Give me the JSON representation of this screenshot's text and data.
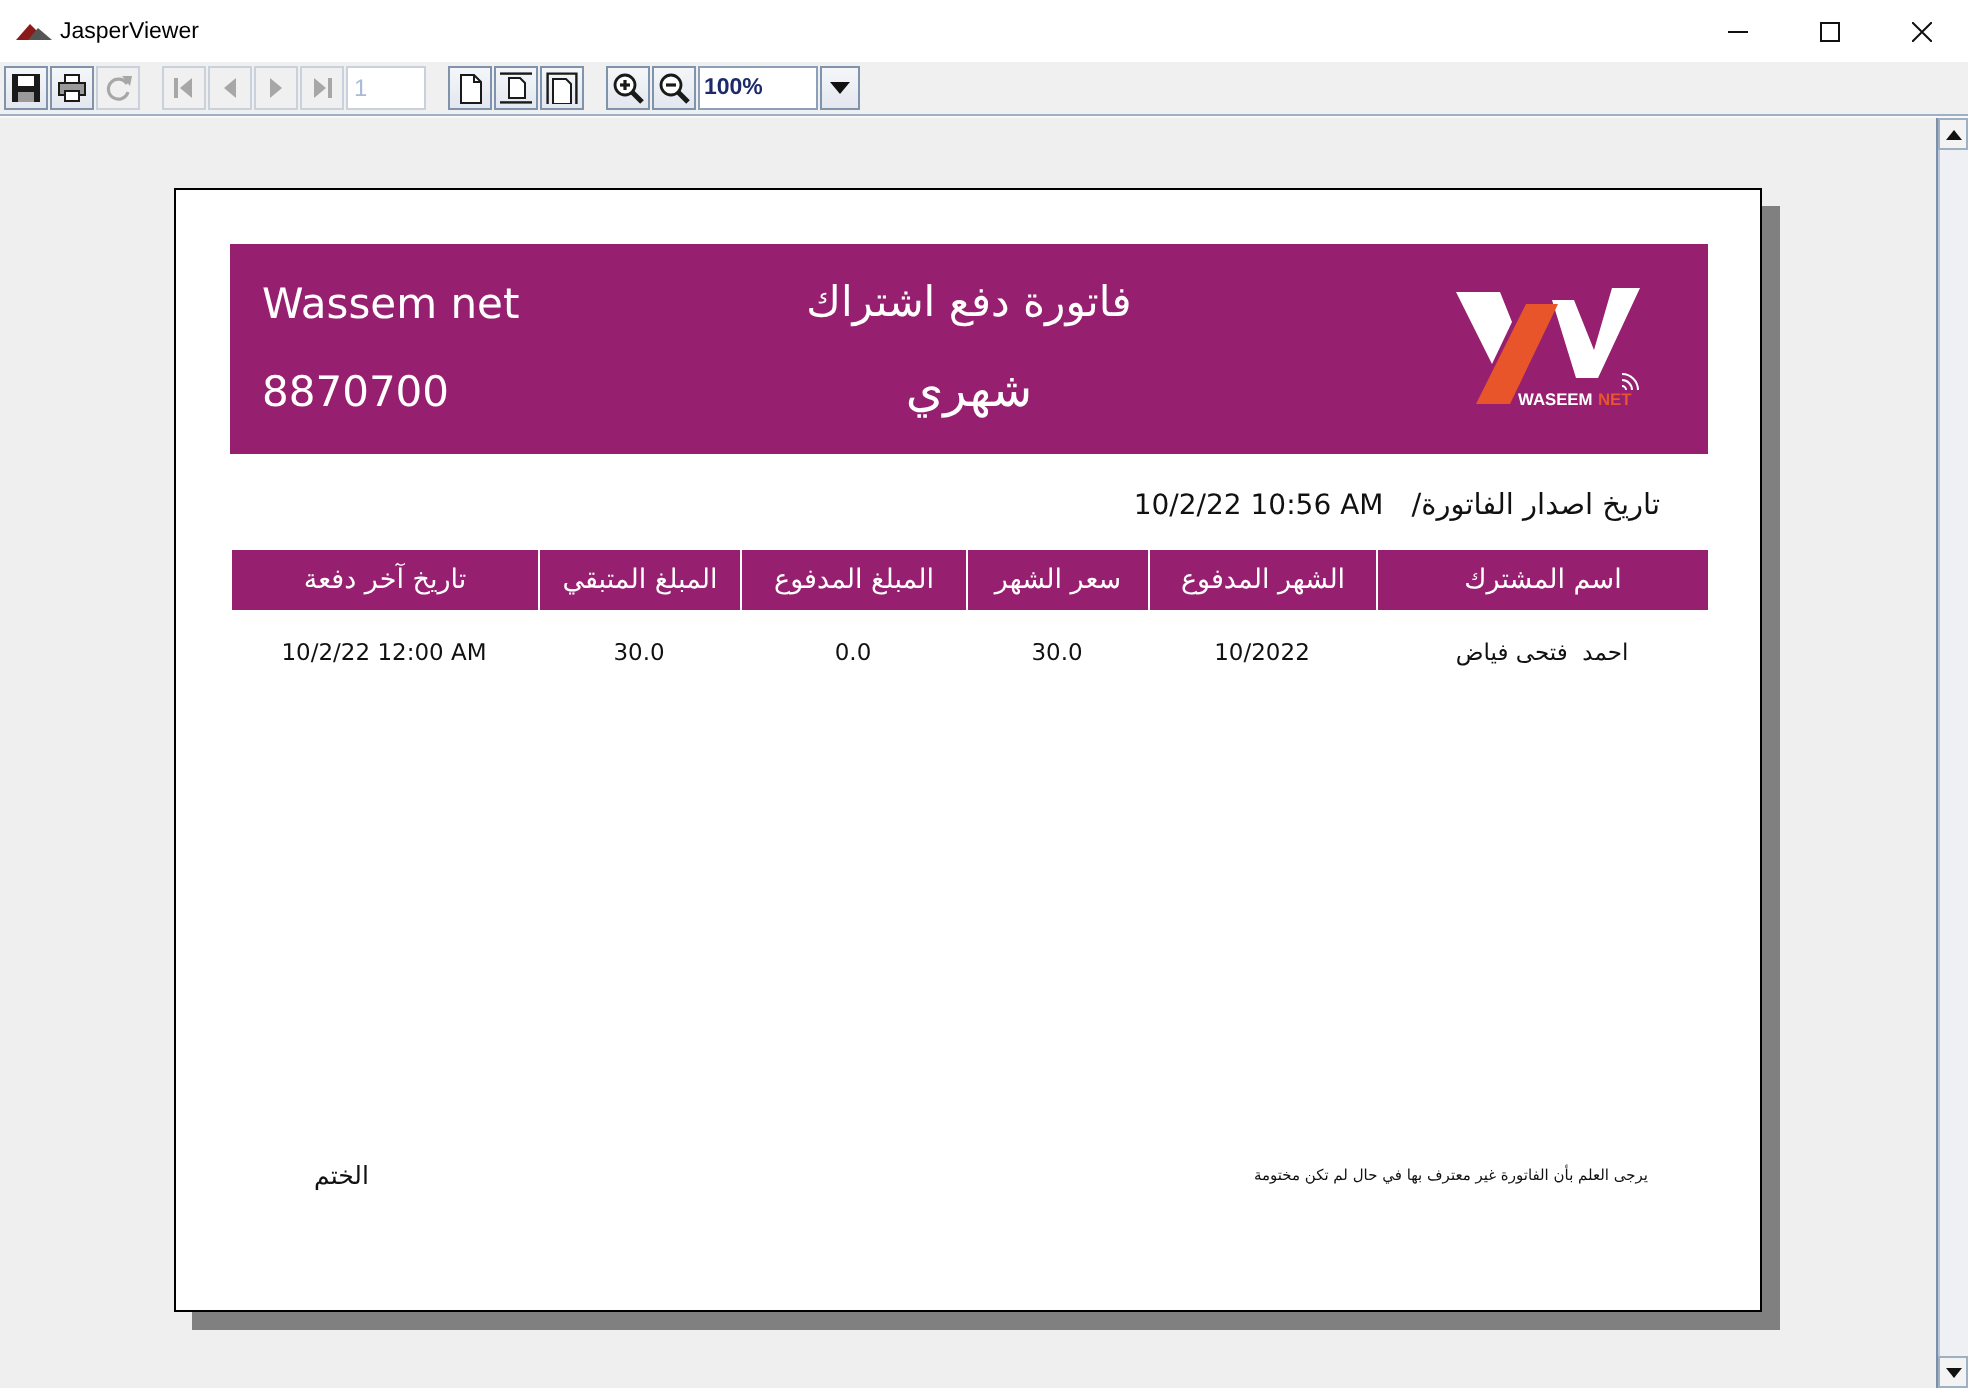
{
  "window": {
    "title": "JasperViewer"
  },
  "toolbar": {
    "file_buttons": [
      {
        "kind": "save",
        "disabled": false
      },
      {
        "kind": "print",
        "disabled": false
      },
      {
        "kind": "reload",
        "disabled": true
      }
    ],
    "page_buttons": [
      {
        "kind": "first",
        "disabled": true
      },
      {
        "kind": "previous",
        "disabled": true
      },
      {
        "kind": "next",
        "disabled": true
      },
      {
        "kind": "last",
        "disabled": true
      }
    ],
    "page_field": {
      "value": "1",
      "disabled": true
    },
    "view_buttons": [
      {
        "kind": "actual-size",
        "disabled": false
      },
      {
        "kind": "fit-page",
        "disabled": false
      },
      {
        "kind": "fit-width",
        "disabled": false
      }
    ],
    "zoom_buttons": [
      {
        "kind": "zoom-in",
        "disabled": false
      },
      {
        "kind": "zoom-out",
        "disabled": false
      }
    ],
    "zoom_field": {
      "value": "100%",
      "disabled": false
    }
  },
  "report": {
    "header": {
      "company": "Wassem net",
      "phone": "8870700",
      "title": "فاتورة دفع اشتراك",
      "subtitle": "شهري",
      "logo": {
        "name": "WASEEM",
        "suffix": "NET"
      }
    },
    "issue_date": {
      "label": "تاريخ اصدار الفاتورة/",
      "value": "10/2/22 10:56 AM"
    },
    "table": {
      "columns": [
        "اسم المشترك",
        "الشهر المدفوع",
        "سعر الشهر",
        "المبلغ المدفوع",
        "المبلغ المتبقي",
        "تاريخ آخر دفعة"
      ],
      "rows": [
        [
          "احمد  فتحى فياض",
          "10/2022",
          "30.0",
          "0.0",
          "30.0",
          "10/2/22 12:00 AM"
        ]
      ]
    },
    "footer": {
      "stamp_label": "الختم",
      "note": "يرجى العلم بأن الفاتورة غير معترف بها في حال لم تكن مختومة"
    }
  }
}
